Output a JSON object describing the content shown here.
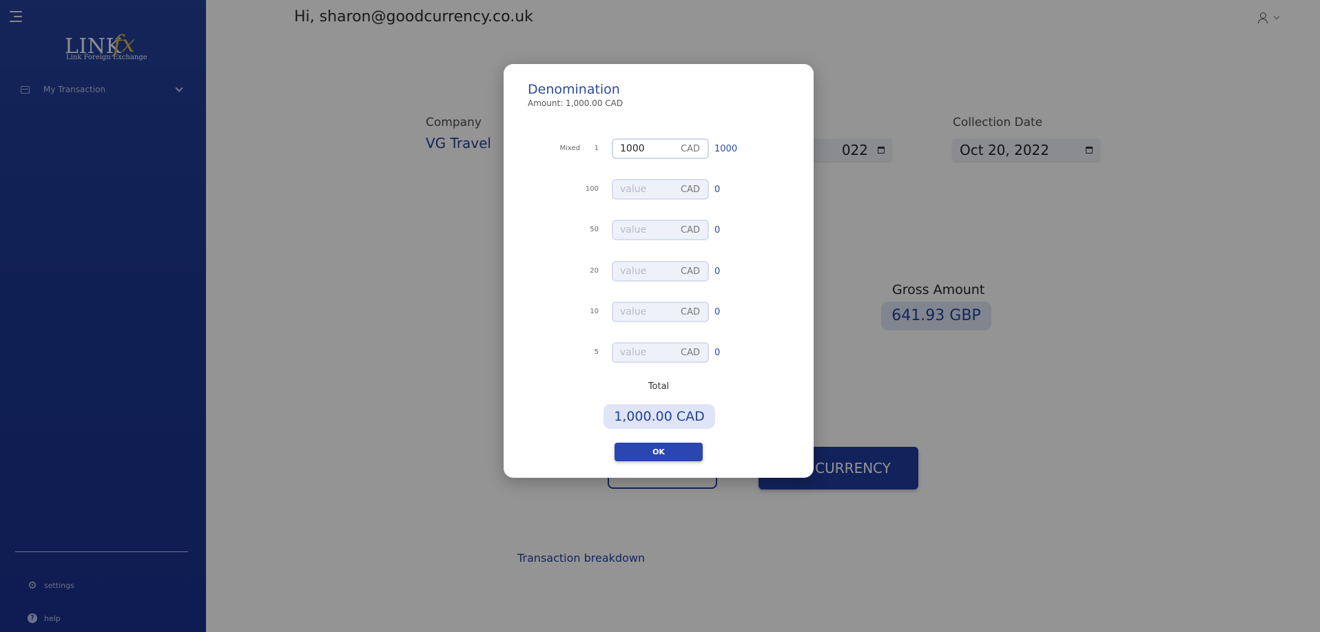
{
  "header": {
    "greeting": "Hi, sharon@goodcurrency.co.uk"
  },
  "brand": {
    "logo_main": "LINK",
    "logo_fx": "fx",
    "logo_tagline": "Link Foreign Exchange"
  },
  "sidebar": {
    "items": [
      {
        "label": "My Transaction",
        "icon": "wallet-icon"
      }
    ],
    "bottom": [
      {
        "label": "settings",
        "icon": "gear-icon"
      },
      {
        "label": "help",
        "icon": "help-icon"
      }
    ]
  },
  "form": {
    "company_label": "Company",
    "company_value": "VG Travel",
    "partial_date": "022",
    "collection_date_label": "Collection Date",
    "collection_date_value": "Oct 20, 2022",
    "gross_label": "Gross Amount",
    "gross_value": "641.93 GBP",
    "currency_button": "CURRENCY",
    "breakdown_link": "Transaction breakdown"
  },
  "modal": {
    "title": "Denomination",
    "subtitle": "Amount: 1,000.00 CAD",
    "rows": [
      {
        "tag": "Mixed",
        "denom": "1",
        "value": "1000",
        "placeholder": "value",
        "currency": "CAD",
        "calc": "1000"
      },
      {
        "tag": "",
        "denom": "100",
        "value": "",
        "placeholder": "value",
        "currency": "CAD",
        "calc": "0"
      },
      {
        "tag": "",
        "denom": "50",
        "value": "",
        "placeholder": "value",
        "currency": "CAD",
        "calc": "0"
      },
      {
        "tag": "",
        "denom": "20",
        "value": "",
        "placeholder": "value",
        "currency": "CAD",
        "calc": "0"
      },
      {
        "tag": "",
        "denom": "10",
        "value": "",
        "placeholder": "value",
        "currency": "CAD",
        "calc": "0"
      },
      {
        "tag": "",
        "denom": "5",
        "value": "",
        "placeholder": "value",
        "currency": "CAD",
        "calc": "0"
      }
    ],
    "total_label": "Total",
    "total_value": "1,000.00 CAD",
    "ok_label": "OK"
  },
  "colors": {
    "sidebar_bg": "#1b3590",
    "accent": "#23419b",
    "pill_bg": "#dfe5f5"
  }
}
